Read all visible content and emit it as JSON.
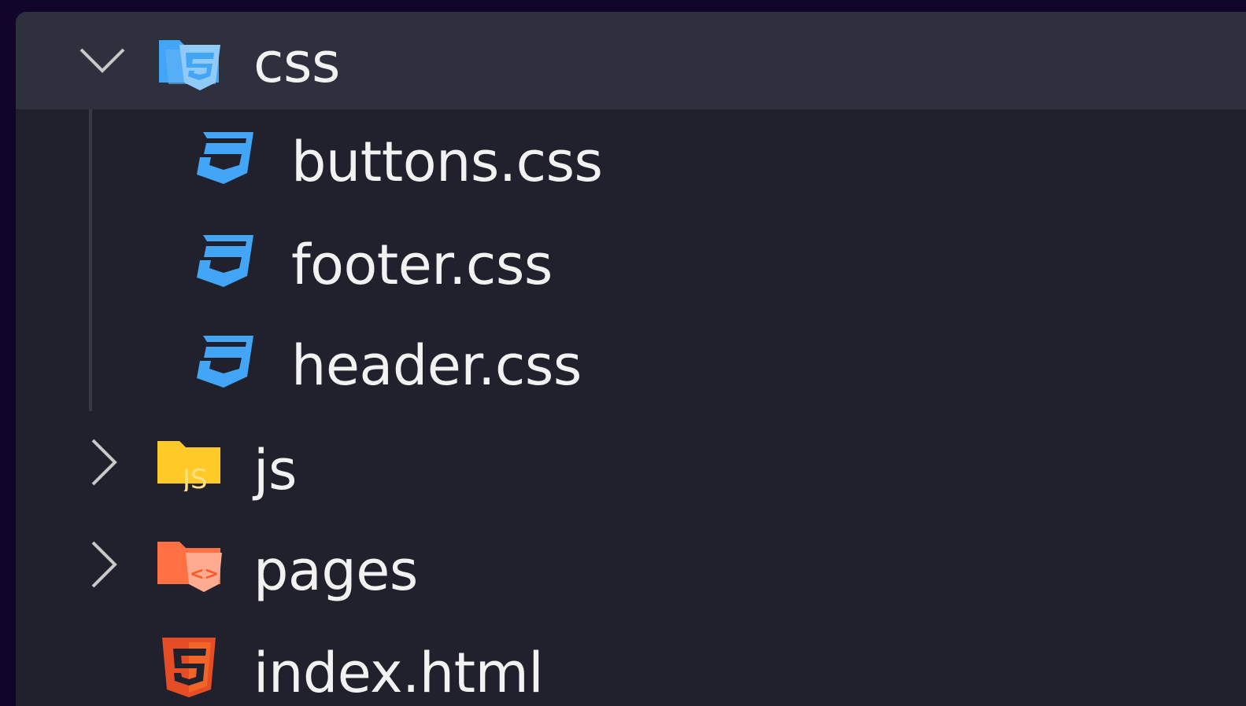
{
  "explorer": {
    "items": [
      {
        "name": "css",
        "kind": "folder",
        "expanded": true,
        "selected": true,
        "icon": "css-folder-icon"
      },
      {
        "name": "buttons.css",
        "kind": "file",
        "icon": "css3-file-icon"
      },
      {
        "name": "footer.css",
        "kind": "file",
        "icon": "css3-file-icon"
      },
      {
        "name": "header.css",
        "kind": "file",
        "icon": "css3-file-icon"
      },
      {
        "name": "js",
        "kind": "folder",
        "expanded": false,
        "icon": "js-folder-icon"
      },
      {
        "name": "pages",
        "kind": "folder",
        "expanded": false,
        "icon": "pages-folder-icon"
      },
      {
        "name": "index.html",
        "kind": "file",
        "icon": "html5-file-icon"
      }
    ]
  },
  "colors": {
    "background": "#21212d",
    "selected_row": "#2f303d",
    "text": "#f2f2f2",
    "css_blue": "#42a5f5",
    "js_yellow": "#ffca28",
    "pages_orange": "#ff7043",
    "html_orange": "#e44d26"
  }
}
